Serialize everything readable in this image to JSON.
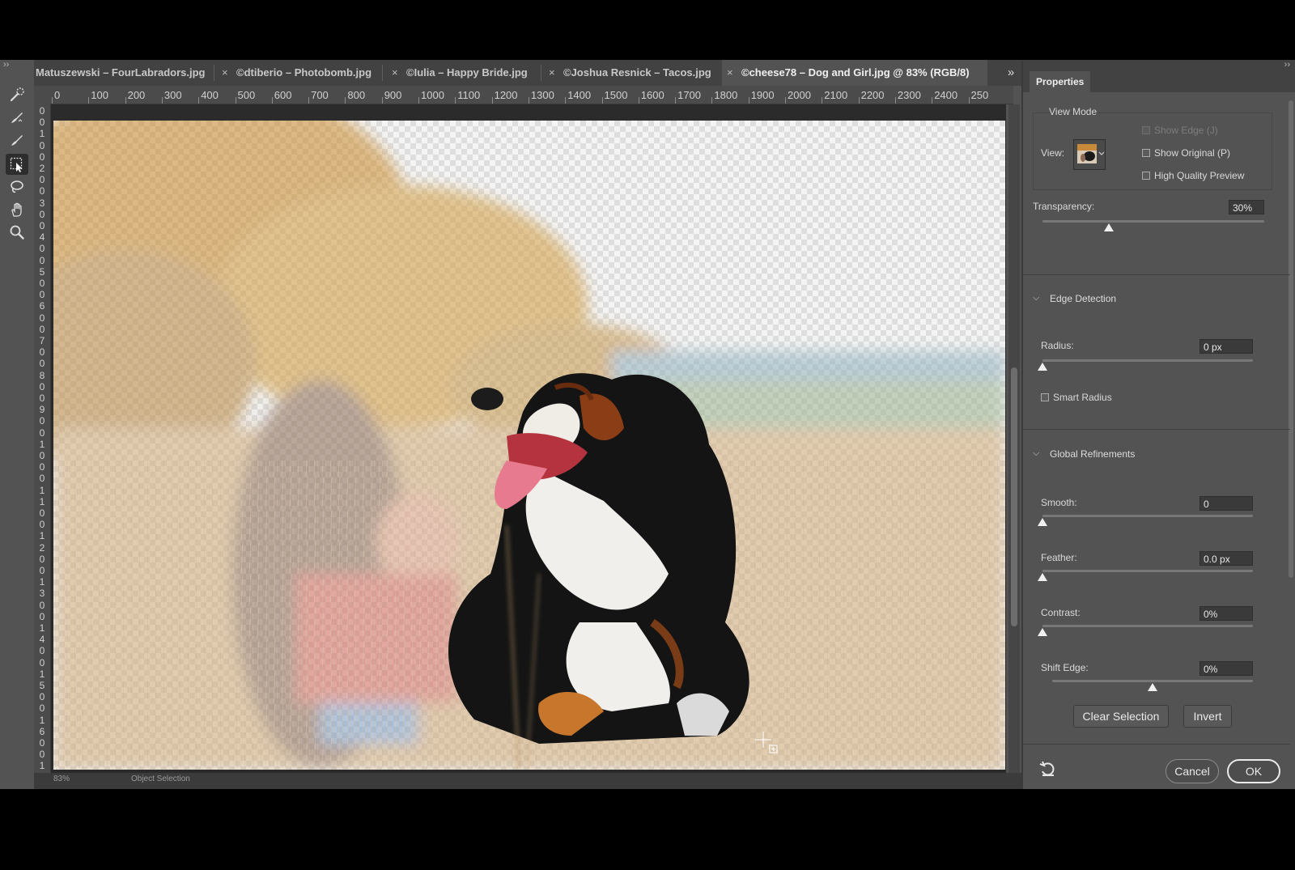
{
  "tabs": [
    {
      "label": "Matuszewski – FourLabradors.jpg",
      "active": false
    },
    {
      "label": "©dtiberio – Photobomb.jpg",
      "active": false
    },
    {
      "label": "©Iulia – Happy Bride.jpg",
      "active": false
    },
    {
      "label": "©Joshua Resnick – Tacos.jpg",
      "active": false
    },
    {
      "label": "©cheese78 – Dog and Girl.jpg @ 83% (RGB/8)",
      "active": true
    }
  ],
  "tab_close_glyph": "×",
  "tab_overflow_glyph": "»",
  "collapse_glyph": "››",
  "toolbar": [
    {
      "name": "quick-selection-brush-icon",
      "active": false
    },
    {
      "name": "refine-edge-brush-icon",
      "active": false
    },
    {
      "name": "brush-icon",
      "active": false
    },
    {
      "name": "object-selection-icon",
      "active": true
    },
    {
      "name": "lasso-icon",
      "active": false
    },
    {
      "name": "hand-icon",
      "active": false
    },
    {
      "name": "zoom-icon",
      "active": false
    }
  ],
  "ruler": {
    "h_labels": [
      "0",
      "100",
      "200",
      "300",
      "400",
      "500",
      "600",
      "700",
      "800",
      "900",
      "1000",
      "1100",
      "1200",
      "1300",
      "1400",
      "1500",
      "1600",
      "1700",
      "1800",
      "1900",
      "2000",
      "2100",
      "2200",
      "2300",
      "2400",
      "250"
    ],
    "v_labels": [
      "0",
      "0",
      "1",
      "0",
      "0",
      "2",
      "0",
      "0",
      "3",
      "0",
      "0",
      "4",
      "0",
      "0",
      "5",
      "0",
      "0",
      "6",
      "0",
      "0",
      "7",
      "0",
      "0",
      "8",
      "0",
      "0",
      "9",
      "0",
      "0",
      "1",
      "0",
      "0",
      "0",
      "1",
      "1",
      "0",
      "0",
      "1",
      "2",
      "0",
      "0",
      "1",
      "3",
      "0",
      "0",
      "1",
      "4",
      "0",
      "0",
      "1",
      "5",
      "0",
      "0",
      "1",
      "6",
      "0",
      "0",
      "1",
      "7",
      "0"
    ]
  },
  "status": {
    "zoom": "83%",
    "mode": "Object Selection"
  },
  "panel": {
    "title": "Properties",
    "view_mode": {
      "title": "View Mode",
      "view_label": "View:",
      "show_edge": {
        "label": "Show Edge (J)",
        "checked": false,
        "enabled": false
      },
      "show_original": {
        "label": "Show Original (P)",
        "checked": false
      },
      "high_quality": {
        "label": "High Quality Preview",
        "checked": false
      }
    },
    "transparency": {
      "label": "Transparency:",
      "value": "30%",
      "level": 0.3
    },
    "edge_detection": {
      "title": "Edge Detection",
      "radius": {
        "label": "Radius:",
        "value": "0 px",
        "level": 0
      },
      "smart_radius": {
        "label": "Smart Radius",
        "checked": false
      }
    },
    "global_refinements": {
      "title": "Global Refinements",
      "smooth": {
        "label": "Smooth:",
        "value": "0",
        "level": 0
      },
      "feather": {
        "label": "Feather:",
        "value": "0.0 px",
        "level": 0
      },
      "contrast": {
        "label": "Contrast:",
        "value": "0%",
        "level": 0
      },
      "shift_edge": {
        "label": "Shift Edge:",
        "value": "0%",
        "level": 0.5
      }
    },
    "buttons": {
      "clear_selection": "Clear Selection",
      "invert": "Invert",
      "cancel": "Cancel",
      "ok": "OK"
    }
  },
  "colors": {
    "panel_bg": "#535353",
    "tab_bg": "#424242",
    "pasteboard": "#2b2b2b",
    "field_bg": "#3a3a3a"
  }
}
